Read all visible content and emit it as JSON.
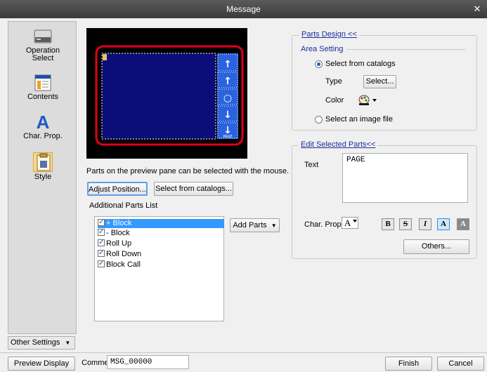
{
  "window": {
    "title": "Message",
    "close_glyph": "✕"
  },
  "sidebar": {
    "items": [
      {
        "label": "Operation Select",
        "icon": "operation-select-icon"
      },
      {
        "label": "Contents",
        "icon": "contents-icon"
      },
      {
        "label": "Char. Prop.",
        "icon": "char-prop-icon"
      },
      {
        "label": "Style",
        "icon": "style-icon",
        "selected": true
      }
    ],
    "other_settings": "Other Settings",
    "dropdown_glyph": "▼"
  },
  "preview": {
    "hint": "Parts on the preview pane can be selected with the mouse.",
    "page_label": "PAGE",
    "side_buttons": [
      "↑",
      "↑",
      "○",
      "↓",
      "↓"
    ]
  },
  "buttons": {
    "adjust_position": "Adjust Position...",
    "select_from_catalogs": "Select from catalogs...",
    "add_parts": "Add Parts",
    "preview_display": "Preview Display",
    "finish": "Finish",
    "cancel": "Cancel",
    "select": "Select...",
    "others": "Others..."
  },
  "additional_parts": {
    "label": "Additional Parts List",
    "items": [
      {
        "label": "+ Block",
        "checked": true,
        "selected": true
      },
      {
        "label": "- Block",
        "checked": true
      },
      {
        "label": "Roll Up",
        "checked": true
      },
      {
        "label": "Roll Down",
        "checked": true
      },
      {
        "label": "Block Call",
        "checked": true
      }
    ]
  },
  "parts_design": {
    "title": "Parts Design <<",
    "area_setting": "Area Setting",
    "select_from_catalogs": "Select from catalogs",
    "type_label": "Type",
    "color_label": "Color",
    "select_image_file": "Select an image file"
  },
  "edit_selected": {
    "title": "Edit Selected Parts<<",
    "text_label": "Text",
    "text_value": "PAGE",
    "char_prop_label": "Char. Prop",
    "char_prop_glyph": "A",
    "style_buttons": [
      "B",
      "S",
      "I",
      "A",
      "A"
    ]
  },
  "comment": {
    "label": "Comme",
    "value": "MSG_00000"
  },
  "colors": {
    "preview_bg": "#000000",
    "preview_panel": "#0d0d7a",
    "highlight": "#e0001a",
    "accent_blue": "#1e5bc6"
  }
}
